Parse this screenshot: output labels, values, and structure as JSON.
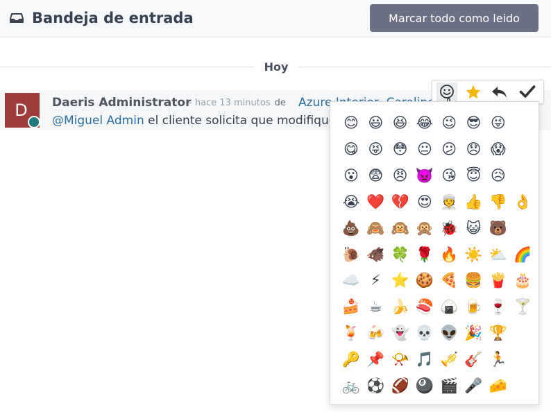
{
  "header": {
    "title": "Bandeja de entrada",
    "mark_all_label": "Marcar todo como leido"
  },
  "separator": {
    "label": "Hoy"
  },
  "message": {
    "avatar_letter": "D",
    "author": "Daeris Administrator",
    "time": "- hace 13 minutos",
    "de": "de",
    "record": "Azure Interior, Caroline",
    "mention": "@Miguel Admin",
    "body": " el cliente solicita que modifiquemos"
  },
  "toolbar": {
    "icons": [
      "smiley-icon",
      "star-icon",
      "reply-icon",
      "check-icon"
    ],
    "star_color": "#f5b800"
  },
  "emoji_picker": {
    "emojis": [
      "😊",
      "😃",
      "😆",
      "😂",
      "😉",
      "😎",
      "😜",
      "😋",
      "😝",
      "😳",
      "😐",
      "😕",
      "😞",
      "😱",
      "😮",
      "😨",
      "😠",
      "👿",
      "😘",
      "😇",
      "😥",
      "😭",
      "❤️",
      "💔",
      "😍",
      "👳",
      "👍",
      "👎",
      "👌",
      "💩",
      "🙈",
      "🙉",
      "🙊",
      "🐞",
      "😺",
      "🐻",
      "🐌",
      "🐗",
      "🍀",
      "🌹",
      "🔥",
      "☀️",
      "⛅",
      "🌈",
      "☁️",
      "⚡",
      "⭐",
      "🍪",
      "🍕",
      "🍔",
      "🍟",
      "🎂",
      "🍰",
      "☕",
      "🍌",
      "🍣",
      "🍙",
      "🍺",
      "🍷",
      "🍸",
      "🍹",
      "🍻",
      "👻",
      "💀",
      "👽",
      "🎉",
      "🏆",
      "🔑",
      "📌",
      "📯",
      "🎵",
      "🎺",
      "🎸",
      "🏃",
      "🚲",
      "⚽",
      "🏈",
      "🎱",
      "🎬",
      "🎤",
      "🧀"
    ]
  }
}
